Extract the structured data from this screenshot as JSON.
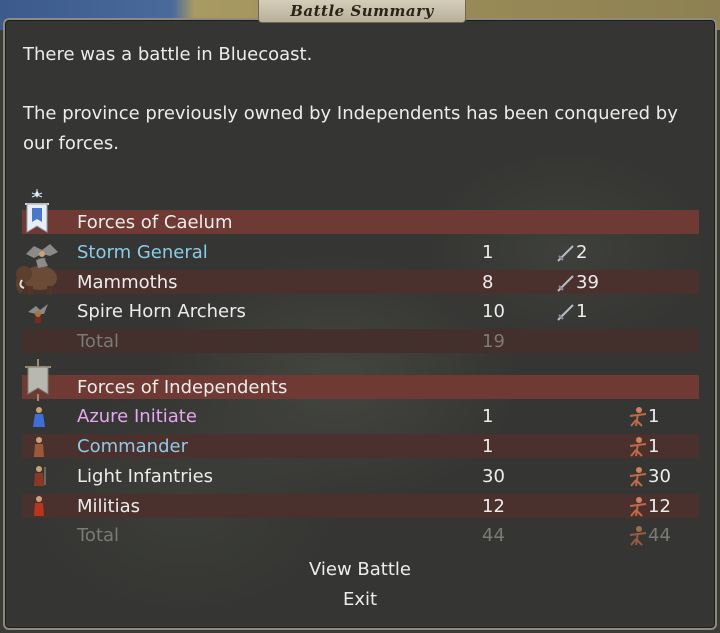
{
  "dialog": {
    "title": "Battle Summary",
    "message_location": "There was a battle in Bluecoast.",
    "message_result": "The province previously owned by Independents has been conquered by our forces."
  },
  "sides": [
    {
      "header": "Forces of Caelum",
      "banner": "caelum-banner-icon",
      "stat_icon": "sword-kills-icon",
      "units": [
        {
          "name": "Storm General",
          "count": "1",
          "stat": "2",
          "style": "hero",
          "icon": "storm-general-icon"
        },
        {
          "name": "Mammoths",
          "count": "8",
          "stat": "39",
          "style": "normal",
          "icon": "mammoth-icon"
        },
        {
          "name": "Spire Horn Archers",
          "count": "10",
          "stat": "1",
          "style": "normal",
          "icon": "archer-icon"
        }
      ],
      "total_label": "Total",
      "total_count": "19"
    },
    {
      "header": "Forces of Independents",
      "banner": "independents-banner-icon",
      "stat_icon": "casualty-icon",
      "units": [
        {
          "name": "Azure Initiate",
          "count": "1",
          "stat": "1",
          "style": "mage",
          "icon": "initiate-icon"
        },
        {
          "name": "Commander",
          "count": "1",
          "stat": "1",
          "style": "hero",
          "icon": "commander-icon"
        },
        {
          "name": "Light Infantries",
          "count": "30",
          "stat": "30",
          "style": "normal",
          "icon": "light-infantry-icon"
        },
        {
          "name": "Militias",
          "count": "12",
          "stat": "12",
          "style": "normal",
          "icon": "militia-icon"
        }
      ],
      "total_label": "Total",
      "total_count": "44",
      "total_stat": "44"
    }
  ],
  "buttons": {
    "view_battle": "View Battle",
    "exit": "Exit"
  },
  "colors": {
    "header_band": "#6e3a33",
    "row_band": "#4b312d",
    "hero_text": "#8ccbe8",
    "mage_text": "#e3a8f0"
  }
}
